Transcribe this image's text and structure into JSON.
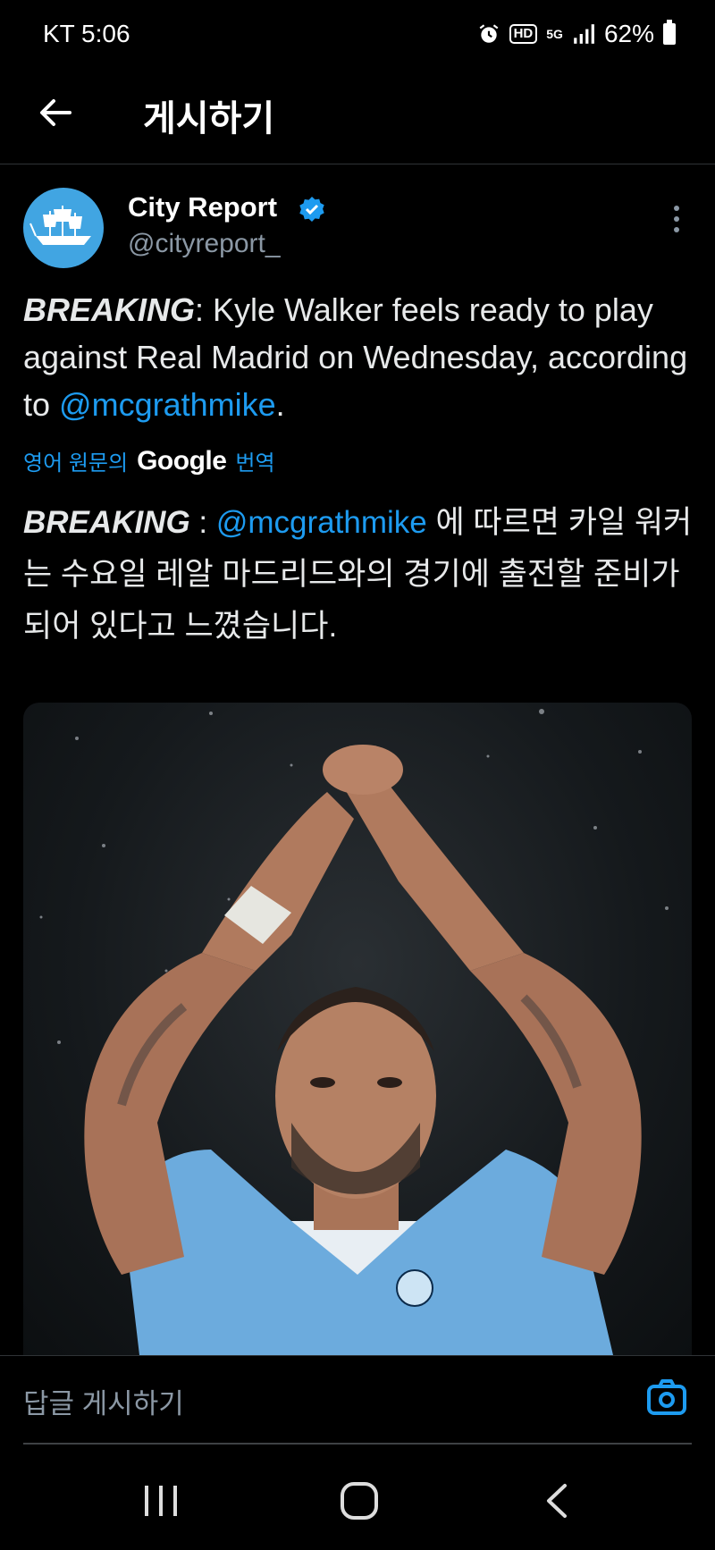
{
  "status_bar": {
    "carrier_time": "KT 5:06",
    "battery": "62%",
    "icons": [
      "alarm-icon",
      "hd-icon",
      "5g-icon",
      "signal-icon",
      "battery-icon"
    ],
    "hd_label": "HD",
    "fiveg_label": "5G"
  },
  "header": {
    "title": "게시하기",
    "back_icon": "back-arrow-icon"
  },
  "tweet": {
    "author_name": "City Report",
    "handle": "@cityreport_",
    "text": {
      "breaking": "BREAKING",
      "body": ": Kyle Walker feels ready to play against Real Madrid on Wednesday, according to ",
      "mention": "@mcgrathmike",
      "end": "."
    },
    "translate": {
      "prefix": "영어 원문의",
      "brand": "Google",
      "suffix": "번역"
    },
    "translated": {
      "breaking": "BREAKING",
      "sep": " : ",
      "mention": "@mcgrathmike",
      "body": " 에 따르면 카일 워커는 수요일 레알 마드리드와의 경기에 출전할 준비가 되어 있다고 느꼈습니다."
    }
  },
  "reply": {
    "placeholder": "답글 게시하기"
  },
  "colors": {
    "accent": "#1d9bf0",
    "avatar_bg": "#41a5e2",
    "muted": "#8b98a5",
    "background": "#000000"
  }
}
